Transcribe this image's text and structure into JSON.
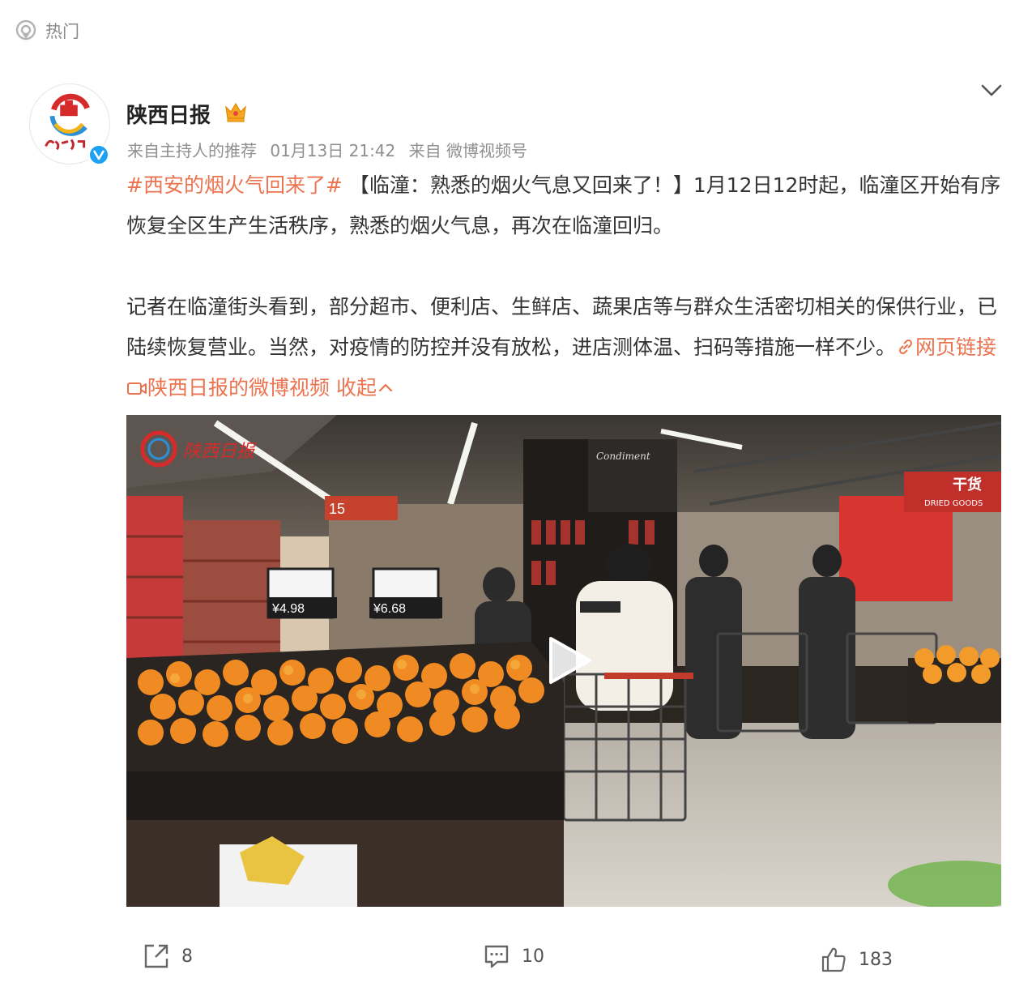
{
  "header": {
    "section_label": "热门"
  },
  "post": {
    "author": {
      "name": "陕西日报"
    },
    "meta": {
      "source_prefix": "来自主持人的推荐",
      "date": "01月13日 21:42",
      "client": "来自 微博视频号"
    },
    "paragraph1": {
      "hashtag": "#西安的烟火气回来了#",
      "text": " 【临潼：熟悉的烟火气息又回来了！】1月12日12时起，临潼区开始有序恢复全区生产生活秩序，熟悉的烟火气息，再次在临潼回归。"
    },
    "paragraph2": {
      "text": "记者在临潼街头看到，部分超市、便利店、生鲜店、蔬果店等与群众生活密切相关的保供行业，已陆续恢复营业。当然，对疫情的防控并没有放松，进店测体温、扫码等措施一样不少。",
      "web_link_label": "网页链接",
      "video_link_label": "陕西日报的微博视频",
      "collapse_label": "收起"
    },
    "video": {
      "watermark": "陕西日报",
      "price_tag_1": "¥4.98",
      "price_tag_2": "¥6.68",
      "section_number": "15",
      "store_sign": "干货",
      "store_sign_sub": "DRIED GOODS",
      "condiment_sign": "Condiment"
    },
    "actions": {
      "reposts": "8",
      "comments": "10",
      "likes": "183"
    }
  },
  "colors": {
    "accent": "#eb7350",
    "verified": "#1da1f2",
    "crown": "#f5a623"
  },
  "icons": [
    "hot-location-icon",
    "verified-badge-icon",
    "crown-icon",
    "chevron-down-icon",
    "link-icon",
    "video-icon",
    "chevron-up-icon",
    "play-icon",
    "repost-icon",
    "comment-icon",
    "like-icon"
  ]
}
